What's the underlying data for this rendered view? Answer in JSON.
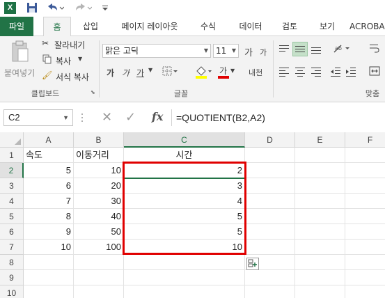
{
  "quick_access": {
    "icons": [
      "excel-logo-icon",
      "save-icon",
      "undo-icon",
      "redo-icon"
    ]
  },
  "tabs": {
    "file": "파일",
    "items": [
      "홈",
      "삽입",
      "페이지 레이아웃",
      "수식",
      "데이터",
      "검토",
      "보기",
      "ACROBA"
    ],
    "active": "홈"
  },
  "ribbon": {
    "clipboard": {
      "paste": "붙여넣기",
      "cut": "잘라내기",
      "copy": "복사",
      "format_painter": "서식 복사",
      "group_label": "클립보드"
    },
    "font": {
      "font_name": "맑은 고딕",
      "font_size": "11",
      "grow": "가",
      "shrink": "가",
      "bold": "가",
      "italic": "가",
      "underline": "가",
      "font_color_glyph": "가",
      "phonetic": "내천",
      "group_label": "글꼴"
    },
    "alignment": {
      "group_label": "맞춤"
    },
    "accent_color": "#217346"
  },
  "formula_bar": {
    "name_box": "C2",
    "cancel_glyph": "✕",
    "enter_glyph": "✓",
    "fx_label": "fx",
    "formula": "=QUOTIENT(B2,A2)"
  },
  "sheet": {
    "columns": [
      "A",
      "B",
      "C",
      "D",
      "E",
      "F"
    ],
    "rows": [
      "1",
      "2",
      "3",
      "4",
      "5",
      "6",
      "7",
      "8",
      "9",
      "10"
    ],
    "selected_column": "C",
    "selected_row": "2",
    "headers": {
      "A": "속도",
      "B": "이동거리",
      "C": "시간"
    },
    "data": [
      {
        "a": "5",
        "b": "10",
        "c": "2"
      },
      {
        "a": "6",
        "b": "20",
        "c": "3"
      },
      {
        "a": "7",
        "b": "30",
        "c": "4"
      },
      {
        "a": "8",
        "b": "40",
        "c": "5"
      },
      {
        "a": "9",
        "b": "50",
        "c": "5"
      },
      {
        "a": "10",
        "b": "100",
        "c": "10"
      }
    ],
    "highlight_color": "#e00000"
  }
}
